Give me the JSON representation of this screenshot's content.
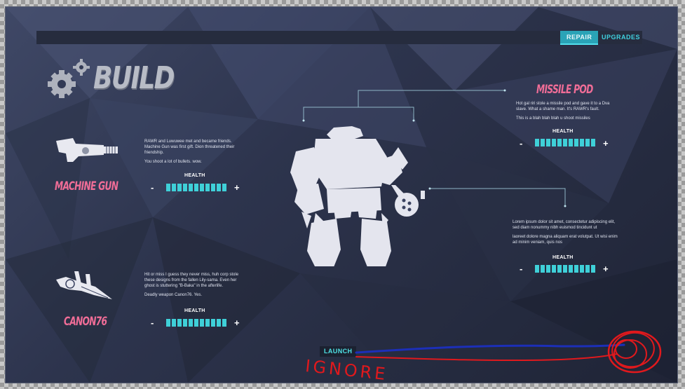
{
  "nav": {
    "tabs": [
      {
        "label": "REPAIR",
        "active": true
      },
      {
        "label": "UPGRADES",
        "active": false
      }
    ]
  },
  "header": {
    "title": "BUILD",
    "icon": "gears-icon"
  },
  "weapons": {
    "machine_gun": {
      "name": "MACHINE GUN",
      "desc": [
        "RAWR and Luwuwee met and became friends. Machine Gun was first gift. Dion threatened their friendship.",
        "You shoot a lot of bullets. wow."
      ],
      "health_label": "HEALTH",
      "minus": "-",
      "plus": "+",
      "health_segments": 11,
      "icon": "machine-gun-icon"
    },
    "canon76": {
      "name": "CANON76",
      "desc": [
        "Hit or miss I guess they never miss, huh corp stole these designs from the fallen Lily-sama. Even her ghost is stuttering \"B-Baka\" in the afterlife.",
        "Deadly weapon Canon76. Yes."
      ],
      "health_label": "HEALTH",
      "minus": "-",
      "plus": "+",
      "health_segments": 11,
      "icon": "canon-icon"
    },
    "missile_pod": {
      "name": "MISSILE POD",
      "desc": [
        "Hot gal riri stole a missile pod and gave it to a Dva slave. What a shame man. It's RAWR's fault.",
        "This is a blah blah blah u shoot missiles"
      ],
      "health_label": "HEALTH",
      "minus": "-",
      "plus": "+",
      "health_segments": 11
    },
    "arm": {
      "desc": [
        "Lorem ipsum dolor sit amet, consectetur adipiscing elit, sed diam nonummy nibh euismod tincidunt ut",
        "laoreet dolore magna aliquam erat volutpat. Ut wisi enim ad minim veniam, quis nos"
      ],
      "health_label": "HEALTH",
      "minus": "-",
      "plus": "+",
      "health_segments": 11
    }
  },
  "launch": {
    "label": "LAUNCH"
  },
  "annotation": {
    "text": "IGNORE"
  },
  "colors": {
    "accent": "#3fd0d8",
    "weapon_name": "#f06d97",
    "background": "#2d344d",
    "annotation_red": "#e0191d",
    "annotation_blue": "#1c2fb8"
  }
}
